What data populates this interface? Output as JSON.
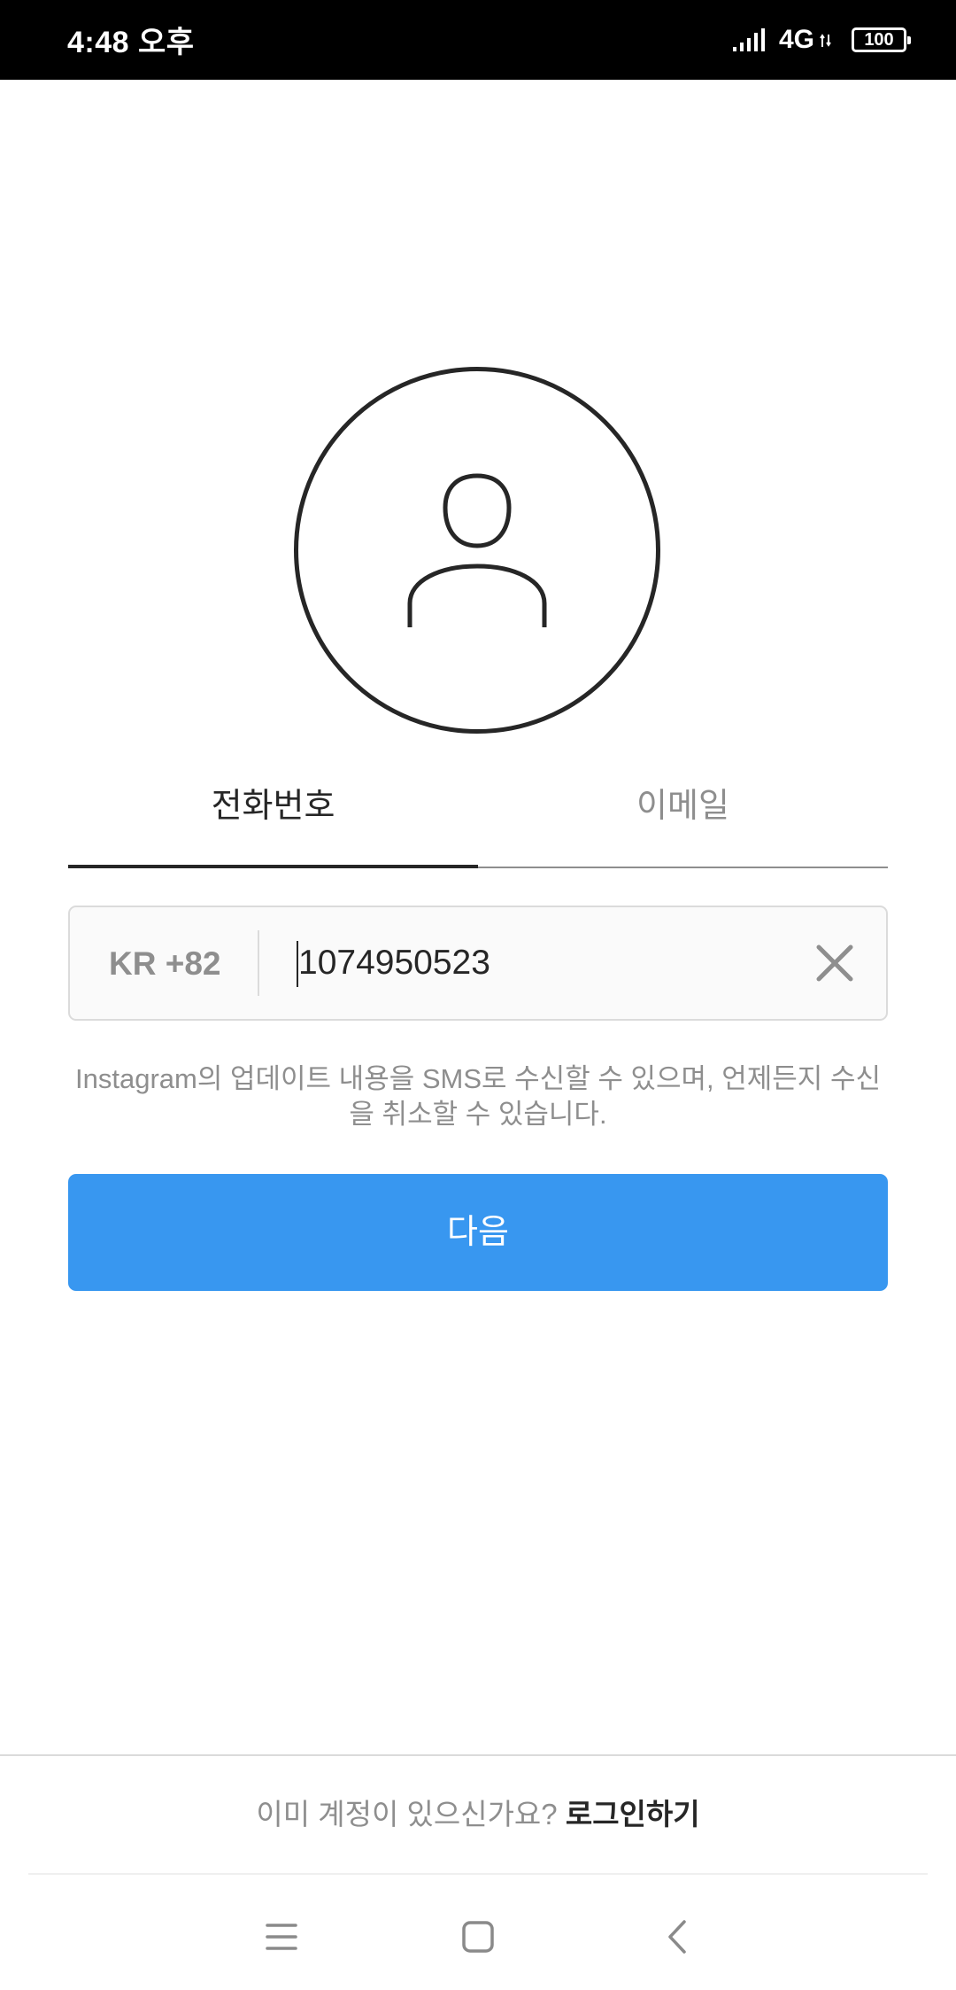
{
  "status_bar": {
    "time": "4:48 오후",
    "network": "4G",
    "battery": "100",
    "icons": [
      "signal-icon",
      "network-arrows-icon",
      "battery-icon"
    ]
  },
  "avatar": {
    "icon": "user-silhouette-icon"
  },
  "tabs": [
    {
      "label": "전화번호",
      "selected": true
    },
    {
      "label": "이메일",
      "selected": false
    }
  ],
  "phone_field": {
    "country_code": "KR +82",
    "value": "1074950523",
    "clear_icon": "close-icon"
  },
  "sms_note": "Instagram의 업데이트 내용을 SMS로 수신할 수 있으며, 언제든지 수신을 취소할 수 있습니다.",
  "next_button": {
    "label": "다음"
  },
  "footer": {
    "prompt": "이미 계정이 있으신가요? ",
    "login_link": "로그인하기"
  },
  "nav_bar": {
    "icons": [
      "menu-icon",
      "home-icon",
      "back-icon"
    ]
  },
  "colors": {
    "primary_button": "#3897f0",
    "text_dark": "#262626",
    "text_gray": "#8e8e8e",
    "border": "#dbdbdb"
  }
}
